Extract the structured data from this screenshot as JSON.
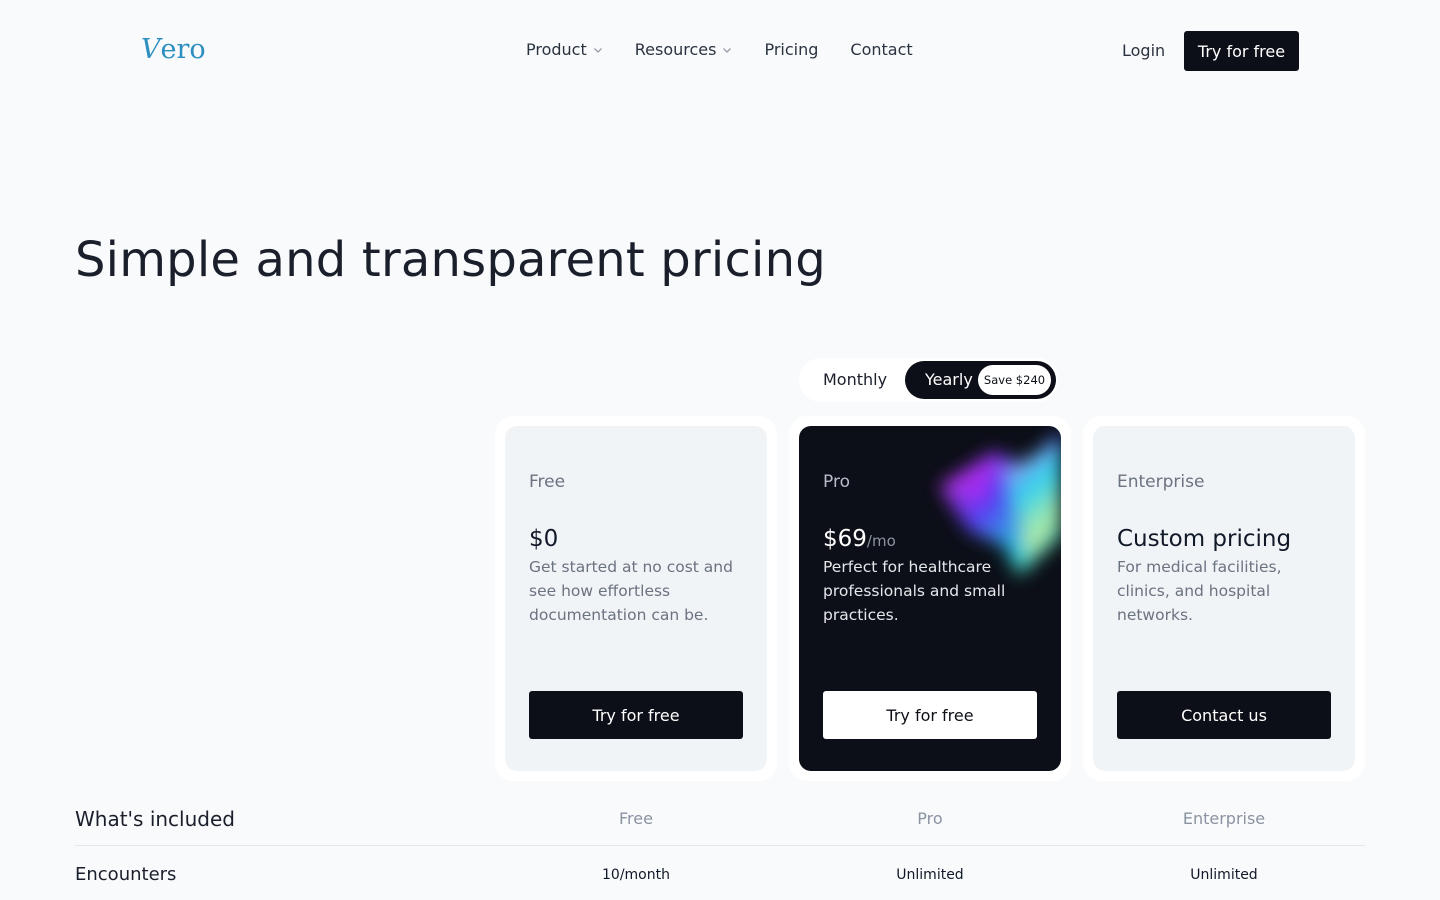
{
  "nav": {
    "logo_v": "V",
    "logo_rest": "ero",
    "links": [
      {
        "label": "Product",
        "dropdown": true
      },
      {
        "label": "Resources",
        "dropdown": true
      },
      {
        "label": "Pricing",
        "dropdown": false
      },
      {
        "label": "Contact",
        "dropdown": false
      }
    ],
    "login": "Login",
    "cta": "Try for free"
  },
  "hero": {
    "title": "Simple and transparent pricing"
  },
  "billing_toggle": {
    "monthly": "Monthly",
    "yearly": "Yearly",
    "save_badge": "Save $240",
    "selected": "Yearly"
  },
  "plans": [
    {
      "name": "Free",
      "price": "$0",
      "per": "",
      "description": "Get started at no cost and see how effortless documentation can be.",
      "button": "Try for free"
    },
    {
      "name": "Pro",
      "price": "$69",
      "per": "/mo",
      "description": "Perfect for healthcare professionals and small practices.",
      "button": "Try for free"
    },
    {
      "name": "Enterprise",
      "price": "Custom pricing",
      "per": "",
      "description": "For medical facilities, clinics, and hospital networks.",
      "button": "Contact us"
    }
  ],
  "comparison": {
    "title": "What's included",
    "columns": [
      "Free",
      "Pro",
      "Enterprise"
    ],
    "rows": [
      {
        "label": "Encounters",
        "values": [
          "10/month",
          "Unlimited",
          "Unlimited"
        ]
      }
    ]
  },
  "colors": {
    "brand": "#2d8fbf",
    "primary_dark": "#0c0f17",
    "background": "#f8fafc"
  }
}
